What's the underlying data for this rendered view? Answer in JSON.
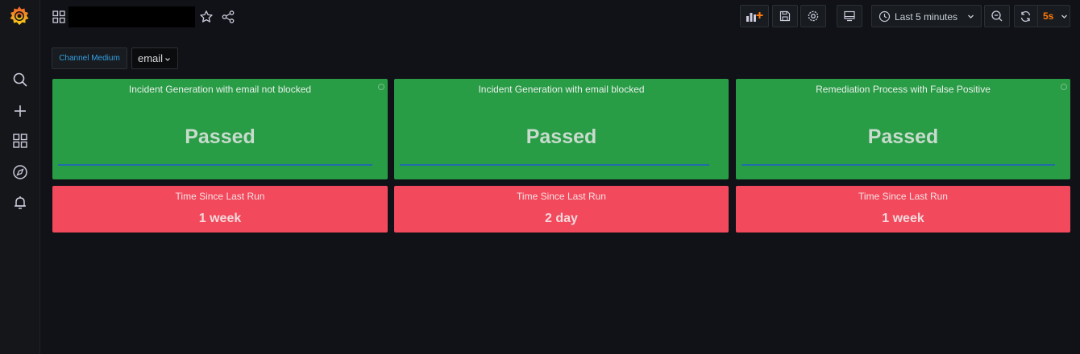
{
  "dashboard": {
    "title": ""
  },
  "timepicker": {
    "label": "Last 5 minutes"
  },
  "refresh": {
    "interval": "5s"
  },
  "variables": {
    "label": "Channel Medium",
    "value": "email"
  },
  "panels": [
    {
      "title": "Incident Generation with email not blocked",
      "value": "Passed"
    },
    {
      "title": "Incident Generation with email blocked",
      "value": "Passed"
    },
    {
      "title": "Remediation Process with False Positive",
      "value": "Passed"
    }
  ],
  "time_panels": [
    {
      "title": "Time Since Last Run",
      "value": "1 week"
    },
    {
      "title": "Time Since Last Run",
      "value": "2 day"
    },
    {
      "title": "Time Since Last Run",
      "value": "1 week"
    }
  ],
  "colors": {
    "passed": "#299c46",
    "stale": "#f2495c",
    "accent": "#ff780a",
    "link": "#33a2e5"
  }
}
